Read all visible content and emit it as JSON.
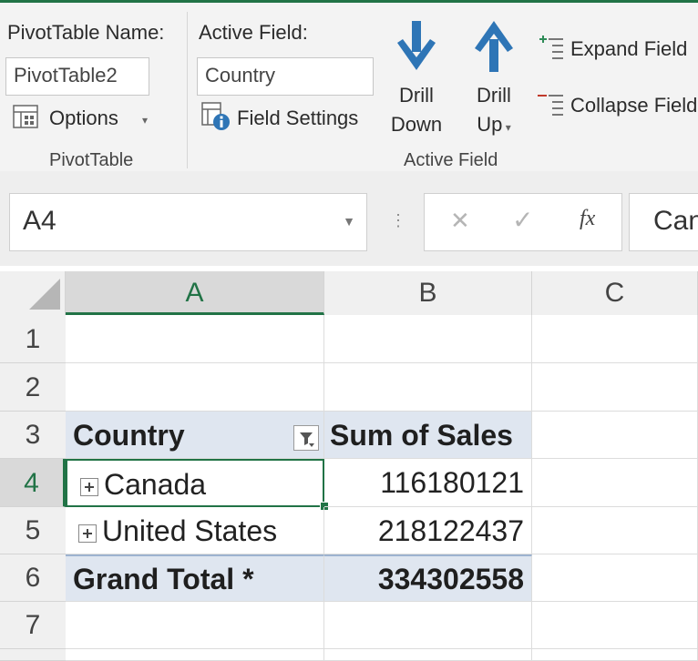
{
  "ribbon": {
    "pivottable_name_label": "PivotTable Name:",
    "pivottable_name_value": "PivotTable2",
    "options_label": "Options",
    "pivottable_group_label": "PivotTable",
    "active_field_label": "Active Field:",
    "active_field_value": "Country",
    "field_settings_label": "Field Settings",
    "drill_down_line1": "Drill",
    "drill_down_line2": "Down",
    "drill_up_line1": "Drill",
    "drill_up_line2": "Up",
    "expand_field_label": "Expand Field",
    "collapse_field_label": "Collapse Field",
    "active_field_group_label": "Active Field"
  },
  "formula_bar": {
    "name_box": "A4",
    "formula_value": "Canada"
  },
  "grid": {
    "columns": [
      "A",
      "B",
      "C"
    ],
    "rows": [
      "1",
      "2",
      "3",
      "4",
      "5",
      "6",
      "7"
    ],
    "header_row_label": "Country",
    "header_value_label": "Sum of Sales",
    "items": [
      {
        "label": "Canada",
        "value": "116180121"
      },
      {
        "label": "United States",
        "value": "218122437"
      }
    ],
    "grand_total_label": "Grand Total *",
    "grand_total_value": "334302558"
  },
  "colors": {
    "accent": "#217346",
    "pivot_header_bg": "#dfe6f0",
    "drill_arrow": "#2e75b6"
  }
}
